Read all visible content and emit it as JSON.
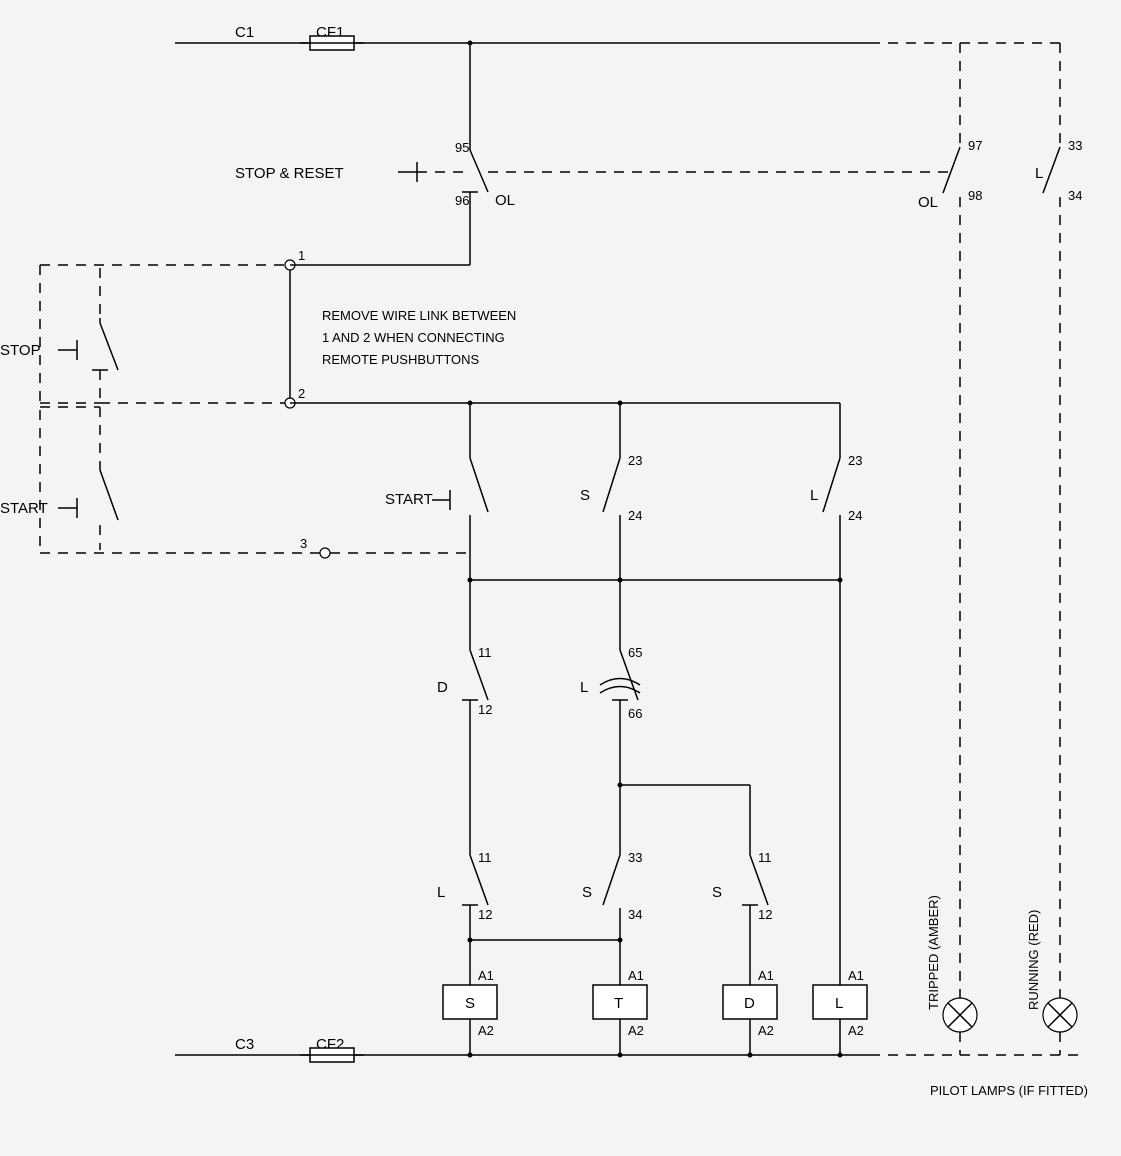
{
  "topRail": {
    "C1": "C1",
    "CF1": "CF1"
  },
  "stopReset": {
    "label": "STOP    &    RESET",
    "OL": "OL",
    "t95": "95",
    "t96": "96"
  },
  "aux1": {
    "OL": "OL",
    "t97": "97",
    "t98": "98"
  },
  "aux2": {
    "L": "L",
    "t33": "33",
    "t34": "34"
  },
  "remoteStop": "STOP",
  "remoteStart": "START",
  "nodes": {
    "n1": "1",
    "n2": "2",
    "n3": "3"
  },
  "note": {
    "l1": "REMOVE WIRE LINK BETWEEN",
    "l2": "1 AND 2 WHEN CONNECTING",
    "l3": "REMOTE PUSHBUTTONS"
  },
  "startLocal": "START",
  "contacts": {
    "S_hold": {
      "name": "S",
      "t1": "23",
      "t2": "24"
    },
    "L_hold": {
      "name": "L",
      "t1": "23",
      "t2": "24"
    },
    "D_nc": {
      "name": "D",
      "t1": "11",
      "t2": "12"
    },
    "L_timer": {
      "name": "L",
      "t1": "65",
      "t2": "66"
    },
    "L_nc": {
      "name": "L",
      "t1": "11",
      "t2": "12"
    },
    "S_no": {
      "name": "S",
      "t1": "33",
      "t2": "34"
    },
    "S_nc": {
      "name": "S",
      "t1": "11",
      "t2": "12"
    }
  },
  "coils": {
    "S": "S",
    "T": "T",
    "D": "D",
    "L": "L",
    "A1": "A1",
    "A2": "A2"
  },
  "lamps": {
    "tripped": "TRIPPED (AMBER)",
    "running": "RUNNING (RED)"
  },
  "bottomRail": {
    "C3": "C3",
    "CF2": "CF2"
  },
  "pilotNote": "PILOT LAMPS (IF FITTED)"
}
